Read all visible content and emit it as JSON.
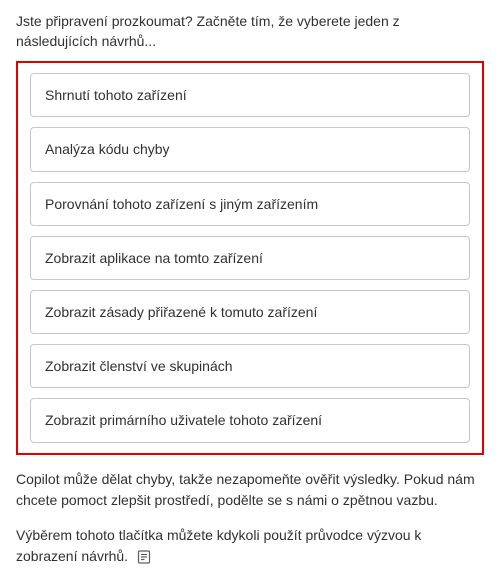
{
  "intro": "Jste připravení prozkoumat? Začněte tím, že vyberete jeden z následujících návrhů...",
  "suggestions": [
    {
      "label": "Shrnutí tohoto zařízení"
    },
    {
      "label": "Analýza kódu chyby"
    },
    {
      "label": "Porovnání tohoto zařízení s jiným zařízením"
    },
    {
      "label": "Zobrazit aplikace na tomto zařízení"
    },
    {
      "label": "Zobrazit zásady přiřazené k tomuto zařízení"
    },
    {
      "label": "Zobrazit členství ve skupinách"
    },
    {
      "label": "Zobrazit primárního uživatele tohoto zařízení"
    }
  ],
  "disclaimer": "Copilot může dělat chyby, takže nezapomeňte ověřit výsledky. Pokud nám chcete pomoct zlepšit prostředí, podělte se s námi o zpětnou vazbu.",
  "footer": "Výběrem tohoto tlačítka můžete kdykoli použít průvodce výzvou k zobrazení návrhů.",
  "footer_icon": "prompt-guide-icon"
}
